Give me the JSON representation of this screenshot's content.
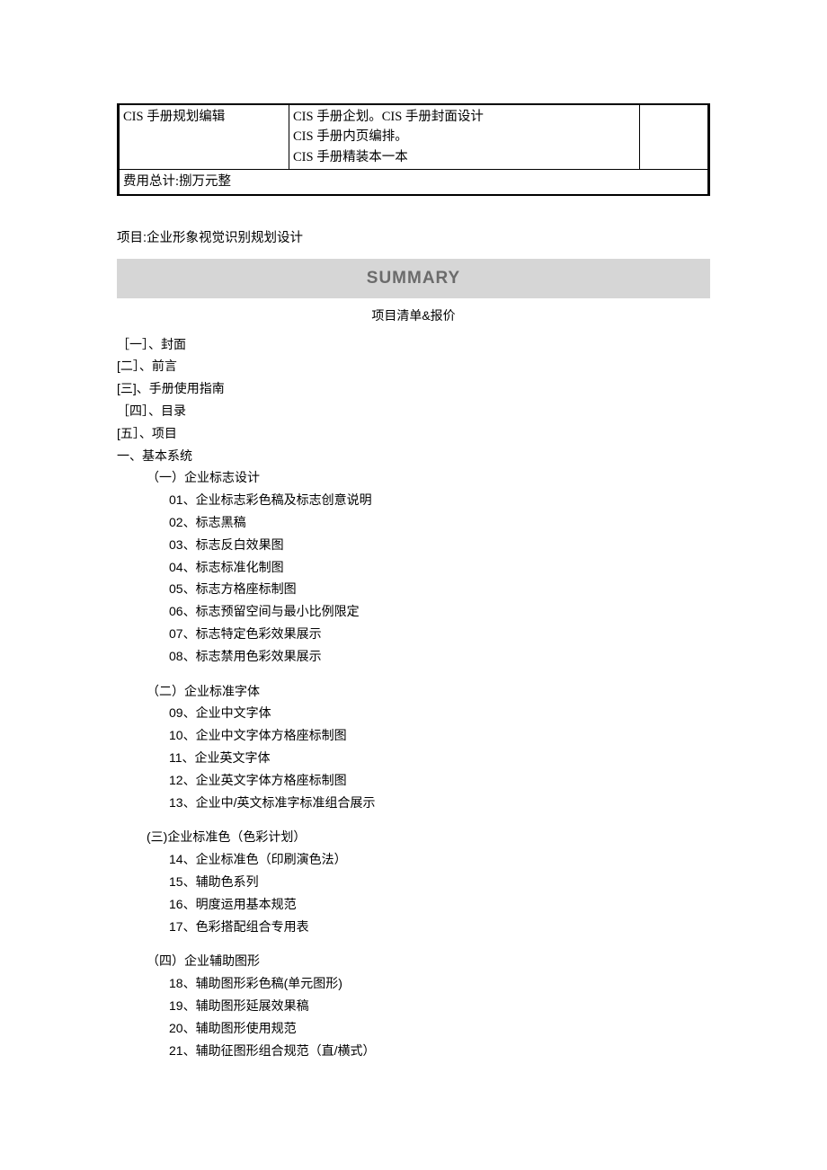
{
  "table": {
    "row1": {
      "c1": "CIS 手册规划编辑",
      "c2": "CIS 手册企划。CIS 手册封面设计\nCIS 手册内页编排。\nCIS 手册精装本一本",
      "c3": ""
    },
    "row2": {
      "full": "费用总计:捌万元整"
    }
  },
  "project_line": "项目:企业形象视觉识别规划设计",
  "summary_heading": "SUMMARY",
  "subtitle": "项目清单&报价",
  "toc": [
    "［一］、封面",
    "[二］、前言",
    "[三]、手册使用指南",
    "［四］、目录",
    "[五］、项目"
  ],
  "main_section": "一、基本系统",
  "groups": [
    {
      "title": "（一）企业标志设计",
      "items": [
        "01、企业标志彩色稿及标志创意说明",
        "02、标志黑稿",
        "03、标志反白效果图",
        "04、标志标准化制图",
        "05、标志方格座标制图",
        "06、标志预留空间与最小比例限定",
        "07、标志特定色彩效果展示",
        "08、标志禁用色彩效果展示"
      ]
    },
    {
      "title": "（二）企业标准字体",
      "items": [
        "09、企业中文字体",
        "10、企业中文字体方格座标制图",
        "11、企业英文字体",
        "12、企业英文字体方格座标制图",
        "13、企业中/英文标准字标准组合展示"
      ]
    },
    {
      "title": "(三)企业标准色（色彩计划）",
      "items": [
        "14、企业标准色（印刷演色法）",
        "15、辅助色系列",
        "16、明度运用基本规范",
        "17、色彩搭配组合专用表"
      ]
    },
    {
      "title": "（四）企业辅助图形",
      "items": [
        "18、辅助图形彩色稿(单元图形)",
        "19、辅助图形延展效果稿",
        "20、辅助图形使用规范",
        "21、辅助征图形组合规范（直/横式）"
      ]
    }
  ]
}
